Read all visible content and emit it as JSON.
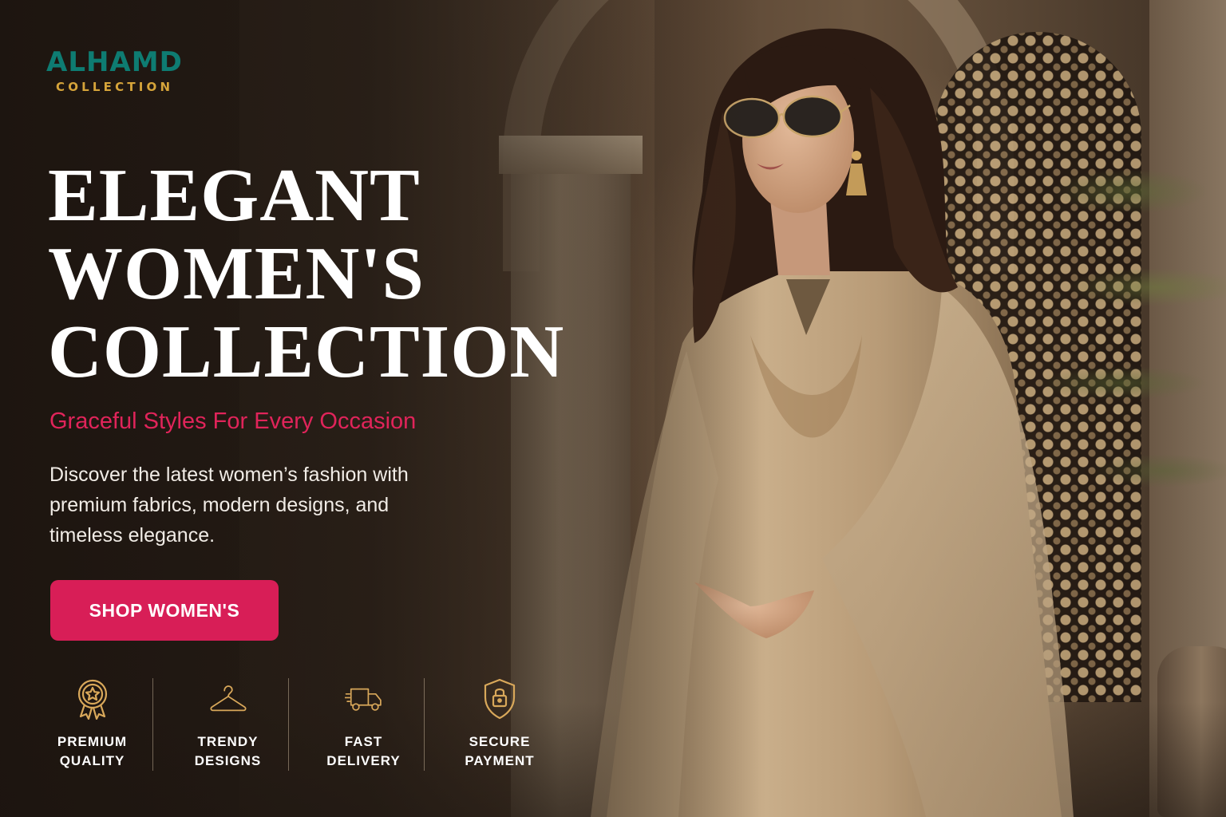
{
  "brand": {
    "name": "ALHAMD",
    "subtitle": "COLLECTION"
  },
  "hero": {
    "headline_lines": [
      "ELEGANT",
      "WOMEN'S",
      "COLLECTION"
    ],
    "tagline": "Graceful Styles For Every Occasion",
    "description": "Discover the latest women’s fashion with premium fabrics, modern designs, and timeless elegance.",
    "cta_label": "SHOP WOMEN'S"
  },
  "features": [
    {
      "icon": "award-badge-icon",
      "label": "PREMIUM\nQUALITY"
    },
    {
      "icon": "hanger-icon",
      "label": "TRENDY\nDESIGNS"
    },
    {
      "icon": "delivery-truck-icon",
      "label": "FAST\nDELIVERY"
    },
    {
      "icon": "shield-lock-icon",
      "label": "SECURE\nPAYMENT"
    }
  ],
  "colors": {
    "brand_teal": "#0e7c72",
    "brand_gold": "#d6a43a",
    "accent_pink": "#d81e57",
    "tagline_pink": "#e0245a",
    "icon_gold": "#d9a85a"
  }
}
